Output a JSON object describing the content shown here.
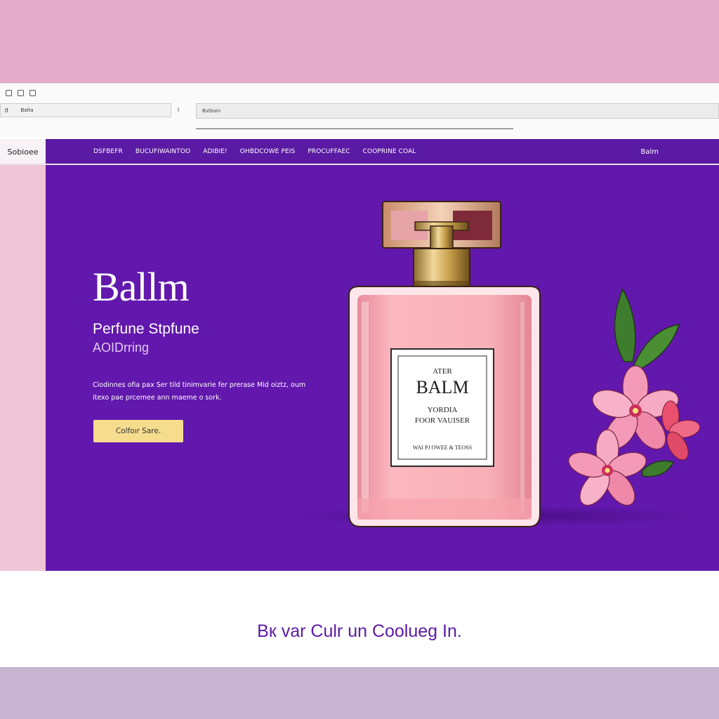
{
  "browser": {
    "url_icon": "tf",
    "url_text": "Balta",
    "url_separator": "i",
    "search_text": "Bstbain"
  },
  "nav": {
    "brand": "Sobioee",
    "links": [
      "DSFBEFR",
      "BUCUFIWAINTOO",
      "ADIBIE!",
      "OHBDCOWE PEIS",
      "PROCUFFAEC",
      "COOPRINE COAL"
    ],
    "right_label": "Balm"
  },
  "hero": {
    "logo": "Ballm",
    "subtitle": "Perfune Stpfune",
    "tagline": "AOIDrring",
    "description": "Ciodinnes ofia pax Ser tild tinimvarie fer prerase Mid oiztz, oum itexo pae prcemee ann maeme o sork.",
    "cta_label": "Colfoır Sare.",
    "bottle_label": {
      "line1": "ATER",
      "line2": "BALM",
      "line3": "YORDIA",
      "line4": "FOOR VAUISER",
      "line5": "WAI PJ OWEE & TEOSS"
    }
  },
  "footer": {
    "tagline": "Bк var Culr un Coolueg In."
  },
  "colors": {
    "hero_bg": "#6218ad",
    "nav_bg": "#5a1aa3",
    "page_bg": "#e4aac9",
    "cta_bg": "#f6dd8e",
    "footer_text": "#5b1aa6"
  },
  "icons": {
    "window_controls": "square-dot-icon",
    "flower": "flower-illustration",
    "bottle": "perfume-bottle-illustration"
  }
}
